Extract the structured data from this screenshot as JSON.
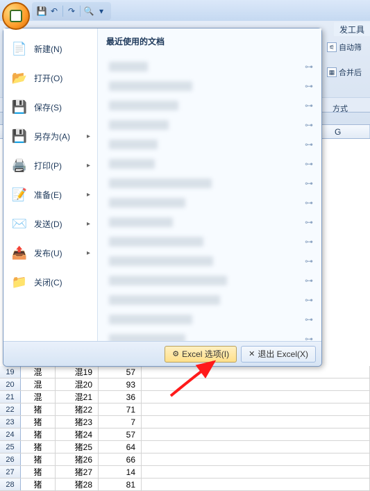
{
  "qat": {
    "save": "💾",
    "undo": "↶",
    "redo": "↷",
    "preview": "🔍"
  },
  "ribbon": {
    "tab_dev": "发工具",
    "auto_filter": "自动筛",
    "merge": "合并后",
    "format": "方式"
  },
  "col_header": "G",
  "menu": {
    "recent_title": "最近使用的文档",
    "new": "新建(N)",
    "open": "打开(O)",
    "save": "保存(S)",
    "saveas": "另存为(A)",
    "print": "打印(P)",
    "prepare": "准备(E)",
    "send": "发送(D)",
    "publish": "发布(U)",
    "close": "关闭(C)",
    "options_btn": "Excel 选项(I)",
    "exit_btn": "退出 Excel(X)",
    "recent_items": [
      {
        "w": 56
      },
      {
        "w": 120
      },
      {
        "w": 100
      },
      {
        "w": 86
      },
      {
        "w": 70
      },
      {
        "w": 66
      },
      {
        "w": 148
      },
      {
        "w": 110
      },
      {
        "w": 92
      },
      {
        "w": 136
      },
      {
        "w": 150
      },
      {
        "w": 170
      },
      {
        "w": 160
      },
      {
        "w": 120
      },
      {
        "w": 110
      },
      {
        "w": 140
      },
      {
        "w": 150
      }
    ]
  },
  "rows": [
    {
      "n": 19,
      "b": "混",
      "c": "混19",
      "d": 57
    },
    {
      "n": 20,
      "b": "混",
      "c": "混20",
      "d": 93
    },
    {
      "n": 21,
      "b": "混",
      "c": "混21",
      "d": 36
    },
    {
      "n": 22,
      "b": "猪",
      "c": "猪22",
      "d": 71
    },
    {
      "n": 23,
      "b": "猪",
      "c": "猪23",
      "d": 7
    },
    {
      "n": 24,
      "b": "猪",
      "c": "猪24",
      "d": 57
    },
    {
      "n": 25,
      "b": "猪",
      "c": "猪25",
      "d": 64
    },
    {
      "n": 26,
      "b": "猪",
      "c": "猪26",
      "d": 66
    },
    {
      "n": 27,
      "b": "猪",
      "c": "猪27",
      "d": 14
    },
    {
      "n": 28,
      "b": "猪",
      "c": "猪28",
      "d": 81
    }
  ]
}
